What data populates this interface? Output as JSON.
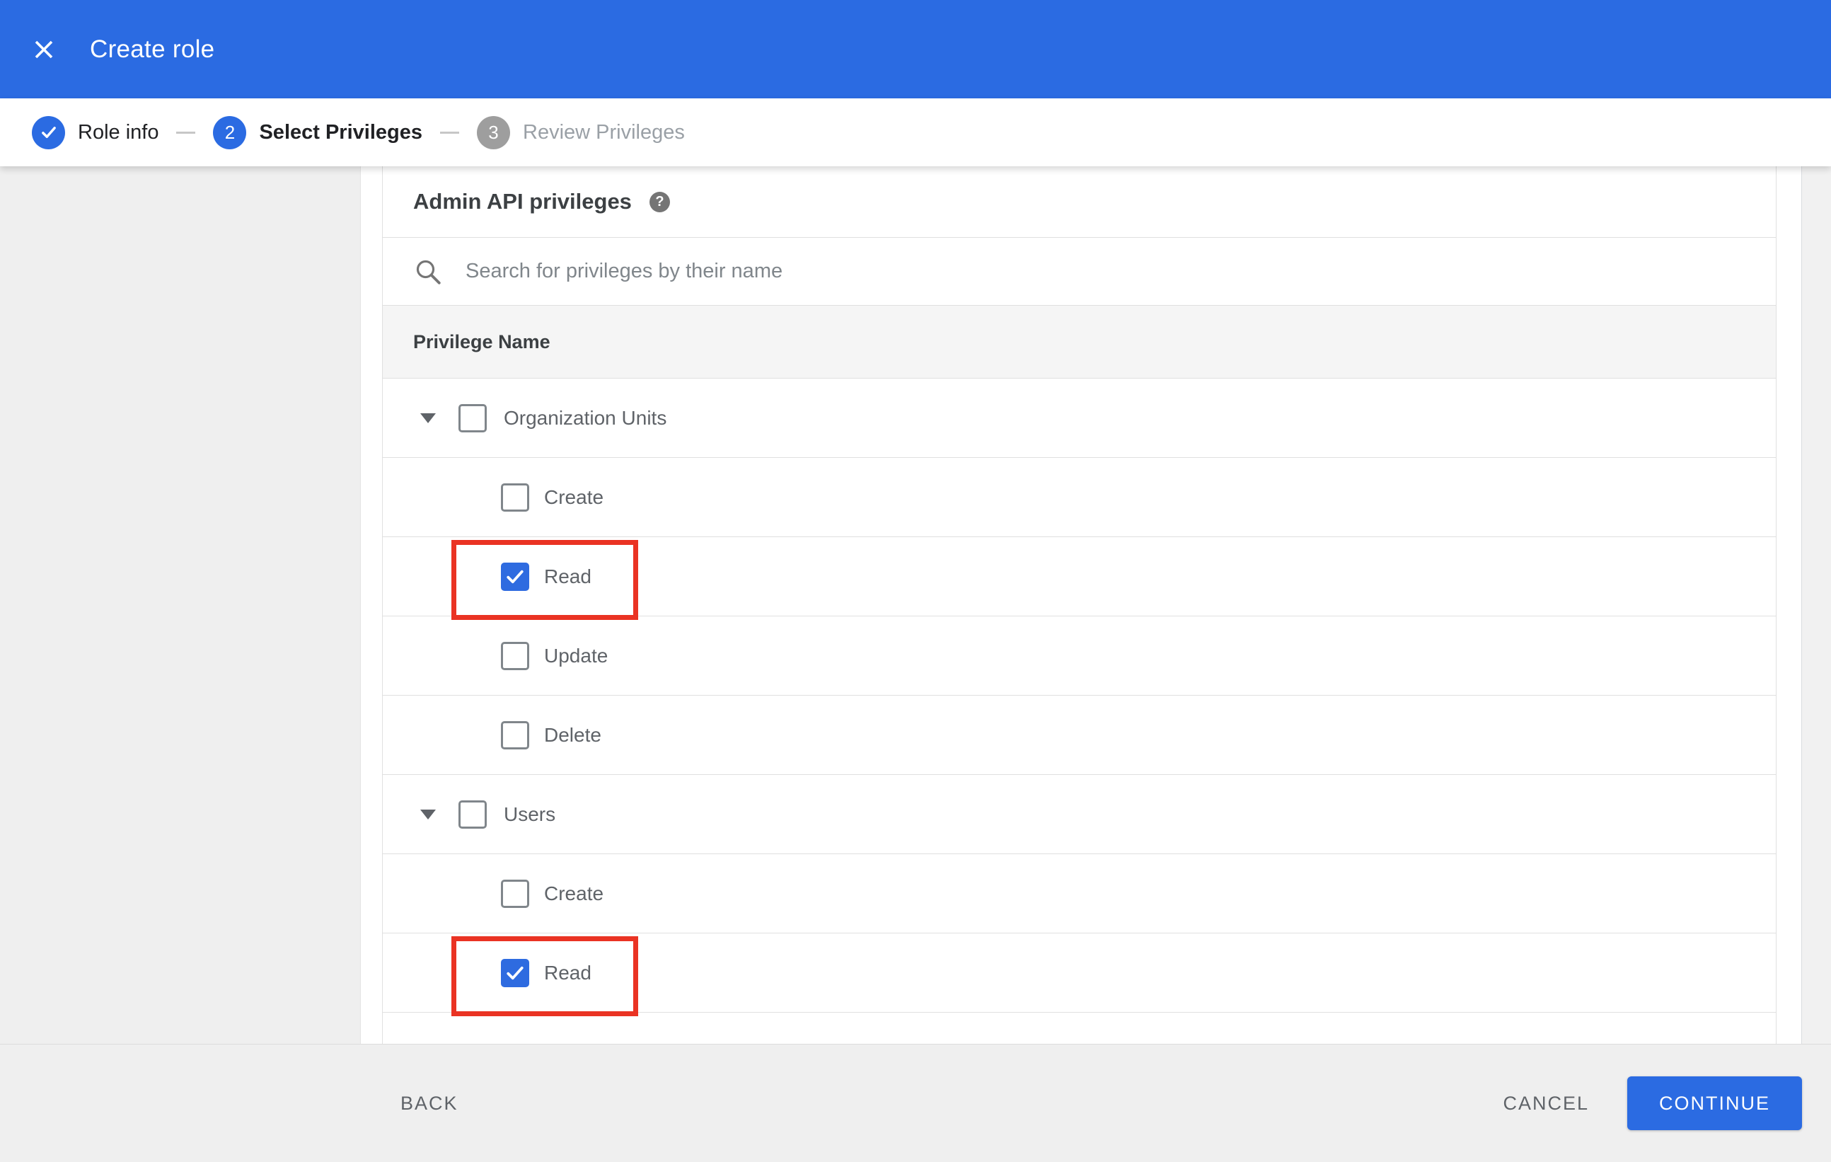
{
  "header": {
    "title": "Create role"
  },
  "stepper": {
    "steps": [
      {
        "label": "Role info",
        "status": "completed"
      },
      {
        "number": "2",
        "label": "Select Privileges",
        "status": "current"
      },
      {
        "number": "3",
        "label": "Review Privileges",
        "status": "upcoming"
      }
    ]
  },
  "content": {
    "heading": "Admin API privileges",
    "help_glyph": "?",
    "search": {
      "placeholder": "Search for privileges by their name",
      "value": ""
    },
    "table": {
      "column_header": "Privilege Name",
      "rows": [
        {
          "label": "Organization Units",
          "type": "group",
          "checked": false,
          "highlighted": false
        },
        {
          "label": "Create",
          "type": "child",
          "checked": false,
          "highlighted": false
        },
        {
          "label": "Read",
          "type": "child",
          "checked": true,
          "highlighted": true
        },
        {
          "label": "Update",
          "type": "child",
          "checked": false,
          "highlighted": false
        },
        {
          "label": "Delete",
          "type": "child",
          "checked": false,
          "highlighted": false
        },
        {
          "label": "Users",
          "type": "group",
          "checked": false,
          "highlighted": false
        },
        {
          "label": "Create",
          "type": "child",
          "checked": false,
          "highlighted": false
        },
        {
          "label": "Read",
          "type": "child",
          "checked": true,
          "highlighted": true
        }
      ]
    }
  },
  "footer": {
    "back": "BACK",
    "cancel": "CANCEL",
    "continue": "CONTINUE"
  },
  "colors": {
    "accent_blue": "#2b6be2",
    "checked_checkbox_blue": "#2e6be0",
    "highlight_red": "#ea3323",
    "panel_gray": "#efefef",
    "table_header_gray": "#f5f5f5",
    "border_gray": "#e0e0e0"
  }
}
